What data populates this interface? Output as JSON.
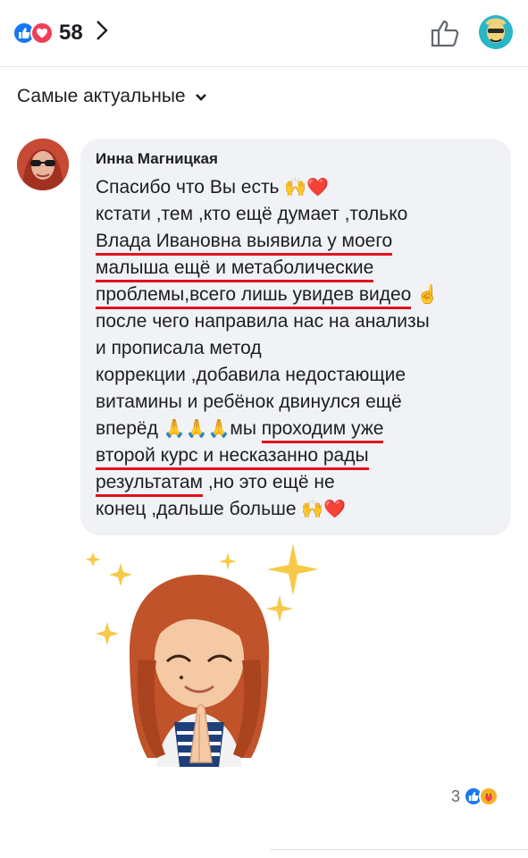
{
  "header": {
    "reaction_count": "58",
    "reaction_icons": [
      "like-icon",
      "love-icon"
    ],
    "brand_color": "#1877f2"
  },
  "sort": {
    "label": "Самые актуальные"
  },
  "comment": {
    "author": "Инна Магницкая",
    "lines": [
      {
        "a": "Спасибо что Вы есть ",
        "emoji": "🙌❤️"
      },
      {
        "a": "кстати ,тем ,кто ещё думает ,только"
      },
      {
        "u": "Влада Ивановна выявила у моего"
      },
      {
        "u": "малыша ещё и метаболические"
      },
      {
        "u": "проблемы,всего лишь увидев видео",
        "emoji": "☝️"
      },
      {
        "a": "после чего направила нас на анализы"
      },
      {
        "a": "и прописала метод"
      },
      {
        "a": "коррекции ,добавила недостающие"
      },
      {
        "a": "витамины и ребёнок двинулся ещё"
      },
      {
        "a": "вперёд ",
        "emoji": "🙏🙏🙏",
        "b": "мы ",
        "u": "проходим уже"
      },
      {
        "u": "второй курс и несказанно рады"
      },
      {
        "u": "результатам",
        "b": " ,но это ещё не"
      },
      {
        "a": "конец ,дальше больше ",
        "emoji": "🙌❤️"
      }
    ],
    "reaction_count": "3",
    "reaction_icons": [
      "like-icon",
      "care-icon"
    ],
    "underline_color": "#e0101e"
  }
}
